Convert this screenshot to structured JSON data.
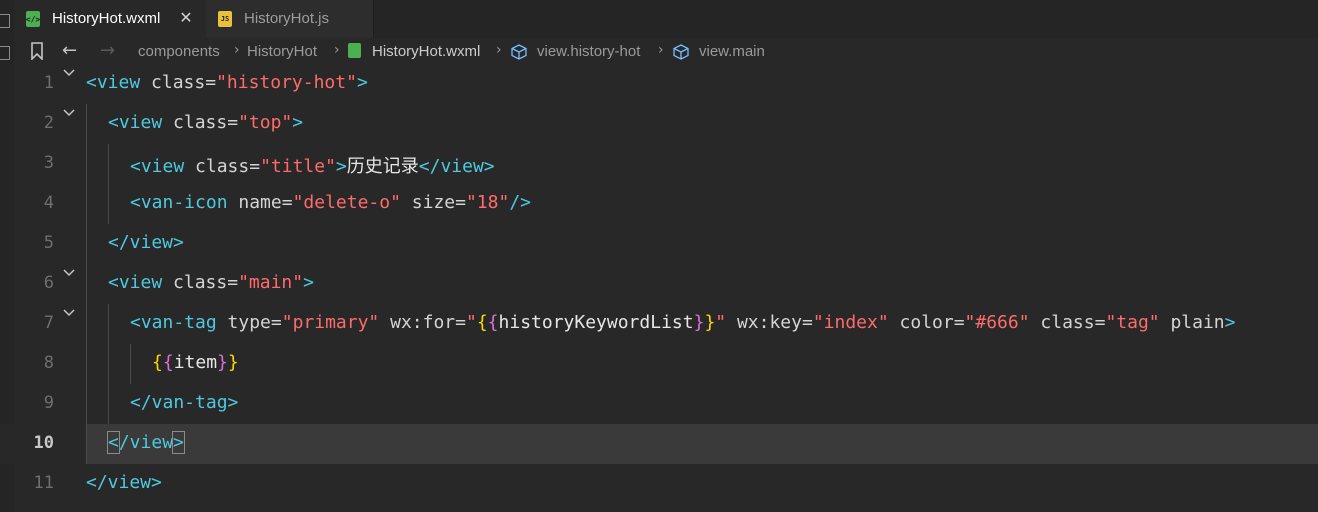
{
  "tabs": [
    {
      "label": "HistoryHot.wxml",
      "icon": "wxml-file-icon",
      "active": true,
      "close": "✕"
    },
    {
      "label": "HistoryHot.js",
      "icon": "js-file-icon",
      "active": false
    }
  ],
  "breadcrumb": {
    "items": [
      "components",
      "HistoryHot",
      "HistoryHot.wxml",
      "view.history-hot",
      "view.main"
    ],
    "separator": "›"
  },
  "editor": {
    "current_line": 10,
    "line_numbers": [
      "1",
      "2",
      "3",
      "4",
      "5",
      "6",
      "7",
      "8",
      "9",
      "10",
      "11"
    ],
    "l1": {
      "open": "<view ",
      "attr": "class=",
      "val": "\"history-hot\"",
      "close": ">"
    },
    "l2": {
      "open": "<view ",
      "attr": "class=",
      "val": "\"top\"",
      "close": ">"
    },
    "l3": {
      "open": "<view ",
      "attr": "class=",
      "val": "\"title\"",
      "close": ">",
      "text": "历史记录",
      "end": "</view>"
    },
    "l4": {
      "open": "<van-icon ",
      "attr1": "name=",
      "val1": "\"delete-o\"",
      "attr2": " size=",
      "val2": "\"18\"",
      "close": "/>"
    },
    "l5": {
      "close": "</view>"
    },
    "l6": {
      "open": "<view ",
      "attr": "class=",
      "val": "\"main\"",
      "close": ">"
    },
    "l7": {
      "open": "<van-tag ",
      "a1": "type=",
      "v1": "\"primary\"",
      "a2": " wx:for=",
      "v2q": "\"",
      "b1": "{",
      "b2": "{",
      "expr": "historyKeywordList",
      "b3": "}",
      "b4": "}",
      "v2e": "\"",
      "a3": " wx:key=",
      "v3": "\"index\"",
      "a4": " color=",
      "v4": "\"#666\"",
      "a5": " class=",
      "v5": "\"tag\"",
      "a6": " plain",
      "close": ">"
    },
    "l8": {
      "b1": "{",
      "b2": "{",
      "expr": "item",
      "b3": "}",
      "b4": "}"
    },
    "l9": {
      "close": "</van-tag>"
    },
    "l10": {
      "lt": "<",
      "tag": "/view",
      "gt": ">"
    },
    "l11": {
      "close": "</view>"
    }
  },
  "colors": {
    "tag": "#4ec9e0",
    "string": "#ff6b6b",
    "brace": "#ffd700",
    "background": "#282828"
  }
}
